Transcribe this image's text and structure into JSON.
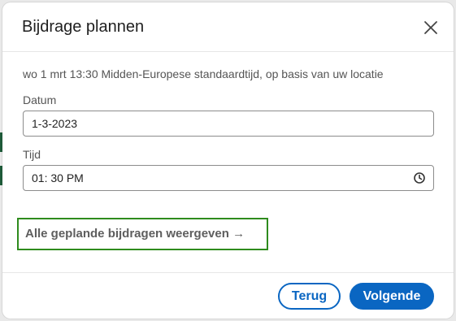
{
  "dialog": {
    "title": "Bijdrage plannen",
    "timezone_note": "wo 1 mrt 13:30 Midden-Europese standaardtijd, op basis van uw locatie"
  },
  "form": {
    "date_label": "Datum",
    "date_value": "1-3-2023",
    "time_label": "Tijd",
    "time_value": "01: 30 PM"
  },
  "links": {
    "view_scheduled": "Alle geplande bijdragen weergeven →"
  },
  "footer": {
    "back_label": "Terug",
    "next_label": "Volgende"
  },
  "colors": {
    "primary": "#0a66c2",
    "focus_outline": "#2e8b1d"
  },
  "icons": {
    "close": "close-icon",
    "clock": "clock-icon"
  }
}
